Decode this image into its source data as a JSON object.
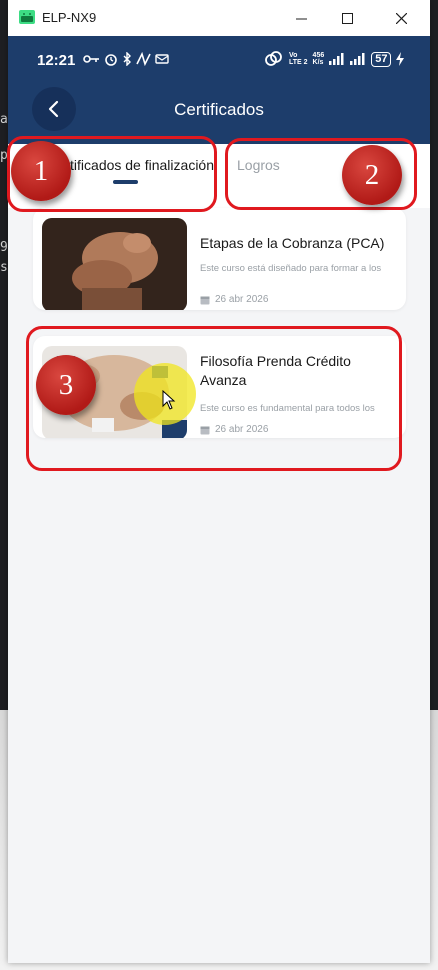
{
  "window": {
    "title": "ELP-NX9",
    "minimize_glyph": "—",
    "maximize_glyph": "☐",
    "close_glyph": "✕"
  },
  "status_bar": {
    "time": "12:21",
    "network_top": "Vo",
    "network_bottom": "LTE 2",
    "speed_top": "456",
    "speed_bottom": "K/s",
    "battery": "57"
  },
  "header": {
    "title": "Certificados",
    "back_icon": "chevron-left-icon"
  },
  "tabs": [
    {
      "label": "Certificados de finalización",
      "active": true
    },
    {
      "label": "Logros",
      "active": false
    }
  ],
  "courses": [
    {
      "title": "Etapas de la Cobranza (PCA)",
      "description": "Este curso está diseñado para formar a los",
      "date": "26 abr 2026",
      "thumbnail": "hand-knocking-image"
    },
    {
      "title": "Filosofía Prenda Crédito Avanza",
      "description": "Este curso es fundamental para todos los",
      "date": "26 abr 2026",
      "thumbnail": "team-hands-image"
    }
  ],
  "annotations": [
    "1",
    "2",
    "3"
  ],
  "colors": {
    "header": "#1d3d6b",
    "callout": "#e0191f",
    "cursor_highlight": "#f0e61e"
  }
}
